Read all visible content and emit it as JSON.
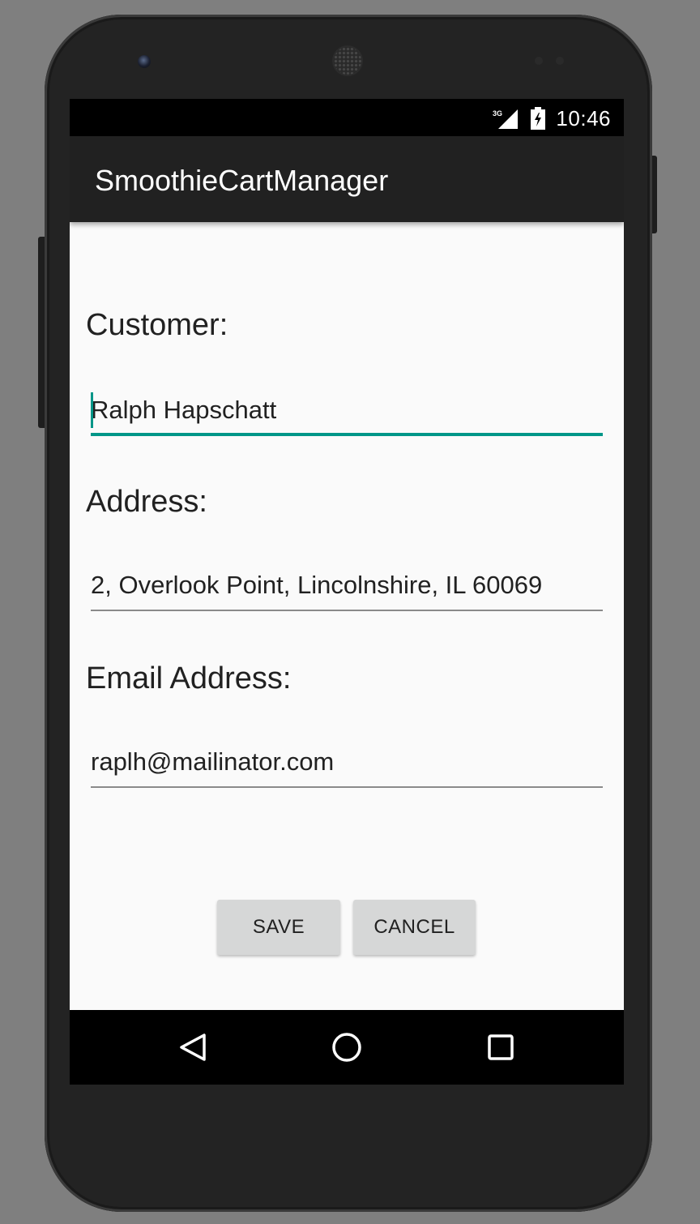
{
  "status_bar": {
    "network": "3G",
    "time": "10:46"
  },
  "app_bar": {
    "title": "SmoothieCartManager"
  },
  "form": {
    "customer_label": "Customer:",
    "customer_value": "Ralph Hapschatt",
    "address_label": "Address:",
    "address_value": "2, Overlook Point, Lincolnshire, IL 60069",
    "email_label": "Email Address:",
    "email_value": "raplh@mailinator.com"
  },
  "buttons": {
    "save_label": "SAVE",
    "cancel_label": "CANCEL"
  },
  "nav_bar": {
    "icons": [
      "back-icon",
      "home-icon",
      "recents-icon"
    ]
  },
  "colors": {
    "accent": "#009688",
    "app_bar": "#212121",
    "background": "#fafafa",
    "button": "#d6d7d7"
  }
}
